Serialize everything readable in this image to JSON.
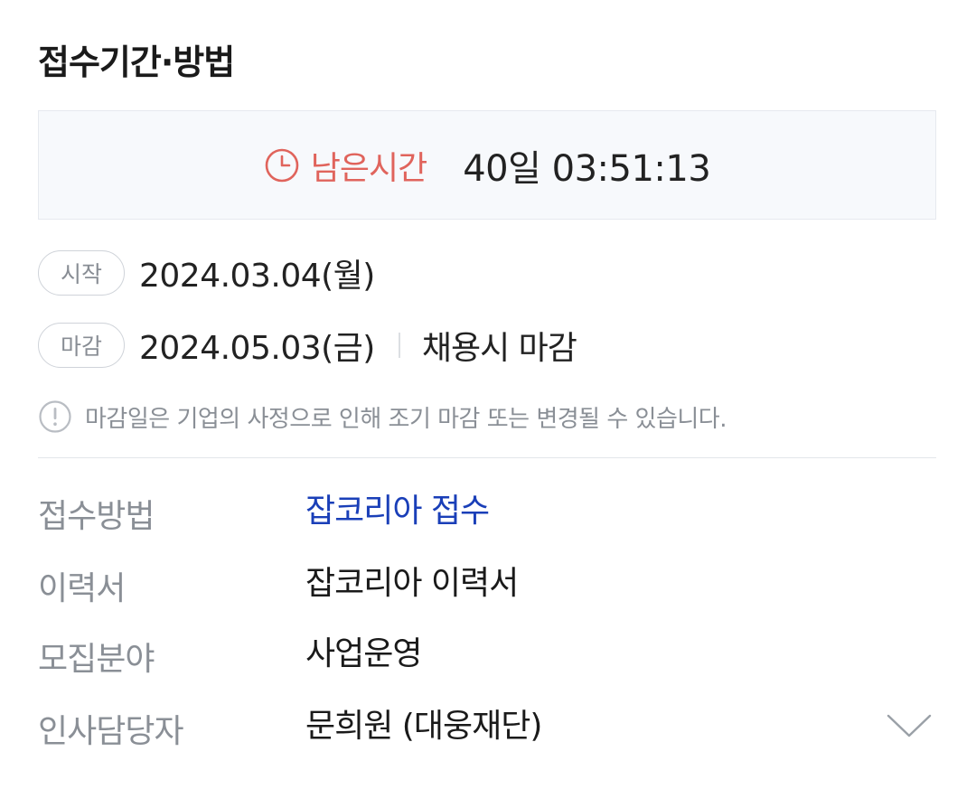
{
  "section": {
    "title": "접수기간·방법"
  },
  "remaining": {
    "label": "남은시간",
    "value": "40일 03:51:13",
    "accent_color": "#e0645c",
    "icon": "clock-icon"
  },
  "dates": {
    "start": {
      "pill": "시작",
      "value": "2024.03.04(월)"
    },
    "end": {
      "pill": "마감",
      "value": "2024.05.03(금)",
      "note": "채용시 마감"
    }
  },
  "notice": {
    "icon": "alert-icon",
    "text": "마감일은 기업의 사정으로 인해 조기 마감 또는 변경될 수 있습니다."
  },
  "info": [
    {
      "label": "접수방법",
      "value": "잡코리아 접수",
      "link_color": "#1a3fb8"
    },
    {
      "label": "이력서",
      "value": "잡코리아 이력서"
    },
    {
      "label": "모집분야",
      "value": "사업운영"
    },
    {
      "label": "인사담당자",
      "value": "문희원 (대웅재단)"
    }
  ],
  "expand": {
    "icon": "chevron-down-icon"
  }
}
